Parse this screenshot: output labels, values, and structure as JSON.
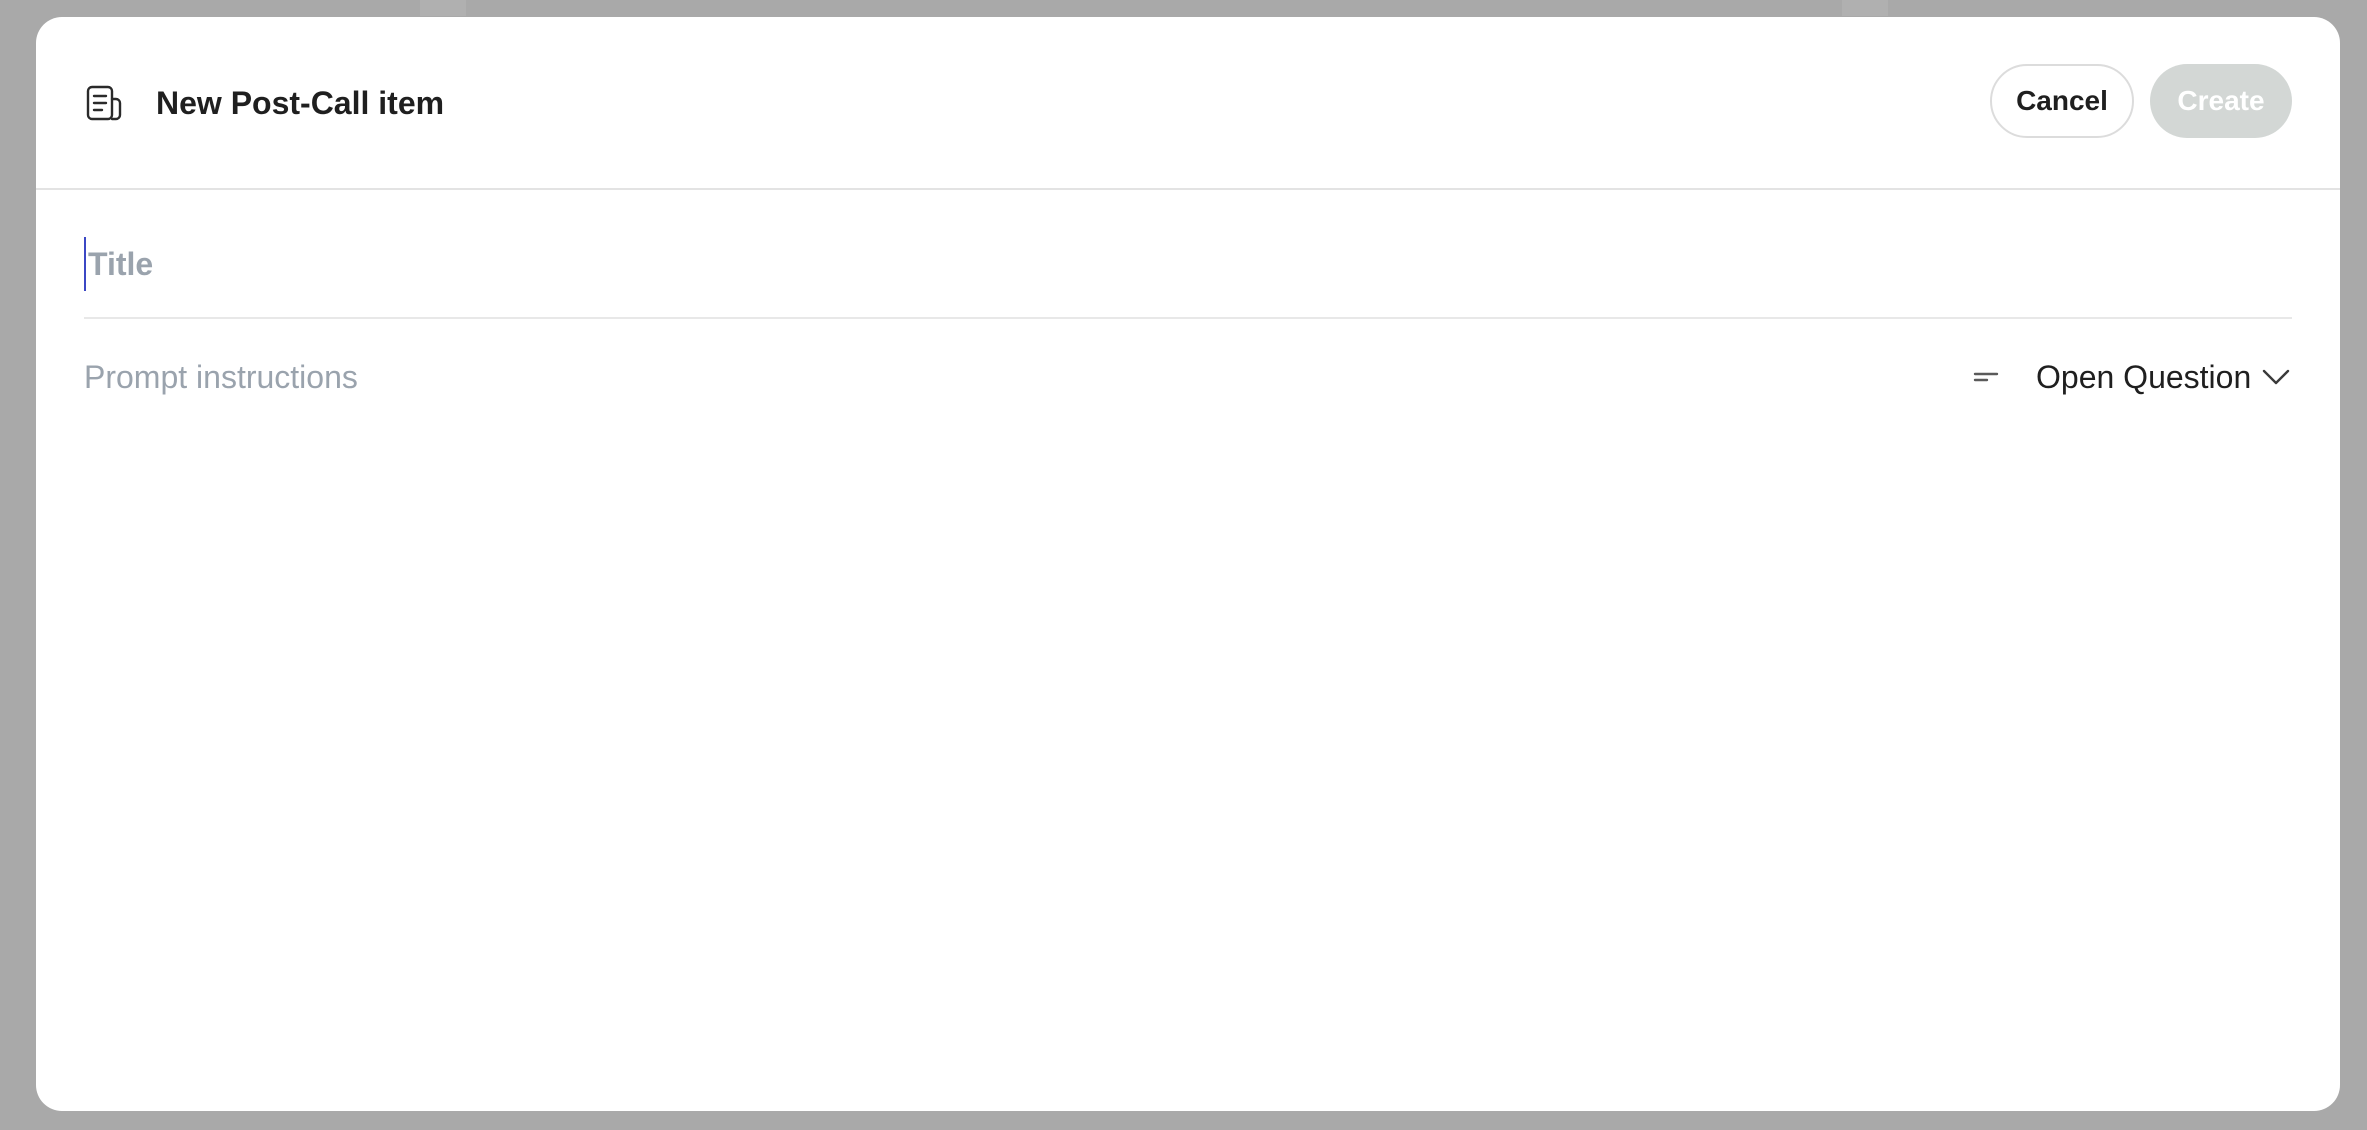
{
  "modal": {
    "title": "New Post-Call item",
    "title_icon": "document-list-icon",
    "cancel_label": "Cancel",
    "create_label": "Create"
  },
  "form": {
    "title_placeholder": "Title",
    "title_value": "",
    "prompt_placeholder": "Prompt instructions",
    "prompt_value": ""
  },
  "type_select": {
    "icon": "short-text-icon",
    "selected": "Open Question",
    "chevron_icon": "chevron-down-icon"
  },
  "colors": {
    "overlay": "#a9a9a9",
    "create_disabled_bg": "#d3d7d5",
    "placeholder": "#9aa3ad",
    "caret": "#3b47c4"
  }
}
